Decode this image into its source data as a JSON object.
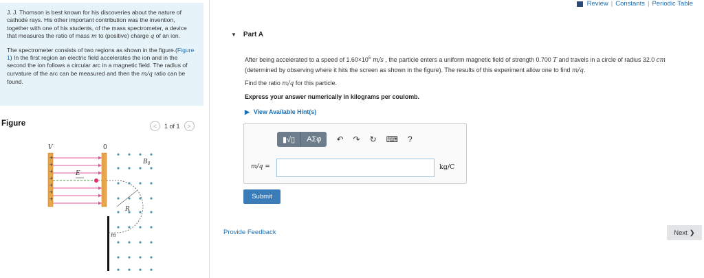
{
  "intro": {
    "para1_pre": "J. J. Thomson is best known for his discoveries about the nature of cathode rays. His other important contribution was the invention, together with one of his students, of the mass spectrometer, a device that measures the ratio of mass ",
    "mass_var": "m",
    "para1_mid": " to (positive) charge ",
    "charge_var": "q",
    "para1_post": " of an ion.",
    "para2_pre": "The spectrometer consists of two regions as shown in the figure.(",
    "figure_link": "Figure 1",
    "para2_mid": ") In the first region an electric field accelerates the ion and in the second the ion follows a circular arc in a magnetic field. The radius of curvature of the arc can be measured and then the ",
    "ratio_var": "m/q",
    "para2_post": " ratio can be found."
  },
  "figure": {
    "title": "Figure",
    "pager_text": "1 of 1",
    "labels": {
      "V": "V",
      "zero": "0",
      "E": "E",
      "B": "B",
      "B_sub": "0",
      "R": "R",
      "m": "m"
    },
    "plus": "+"
  },
  "toplinks": {
    "review": "Review",
    "sep": "|",
    "constants": "Constants",
    "periodic": "Periodic Table"
  },
  "part": {
    "label": "Part A"
  },
  "question": {
    "pre": "After being accelerated to a speed of 1.60×10",
    "exp": "5",
    "speed_unit": " m/s",
    "mid": " , the particle enters a uniform magnetic field of strength 0.700 ",
    "field_unit": "T",
    "mid2": " and travels in a circle of radius 32.0 ",
    "len_unit": "cm",
    "post": " (determined by observing where it hits the screen as shown in the figure). The results of this experiment allow one to find ",
    "ratio": "m/q",
    "end": "."
  },
  "find": {
    "pre": "Find the ratio ",
    "ratio": "m/q",
    "post": " for this particle."
  },
  "express": "Express your answer numerically in kilograms per coulomb.",
  "hints": {
    "label": "View Available Hint(s)"
  },
  "answer": {
    "label": "m/q =",
    "value": "",
    "unit": "kg/C",
    "toolbar": {
      "templates": "▮√▯",
      "symbols": "ΑΣφ",
      "undo": "↶",
      "redo": "↷",
      "reset": "↻",
      "keyboard": "⌨",
      "help": "?"
    }
  },
  "submit_label": "Submit",
  "feedback_label": "Provide Feedback",
  "next_label": "Next"
}
